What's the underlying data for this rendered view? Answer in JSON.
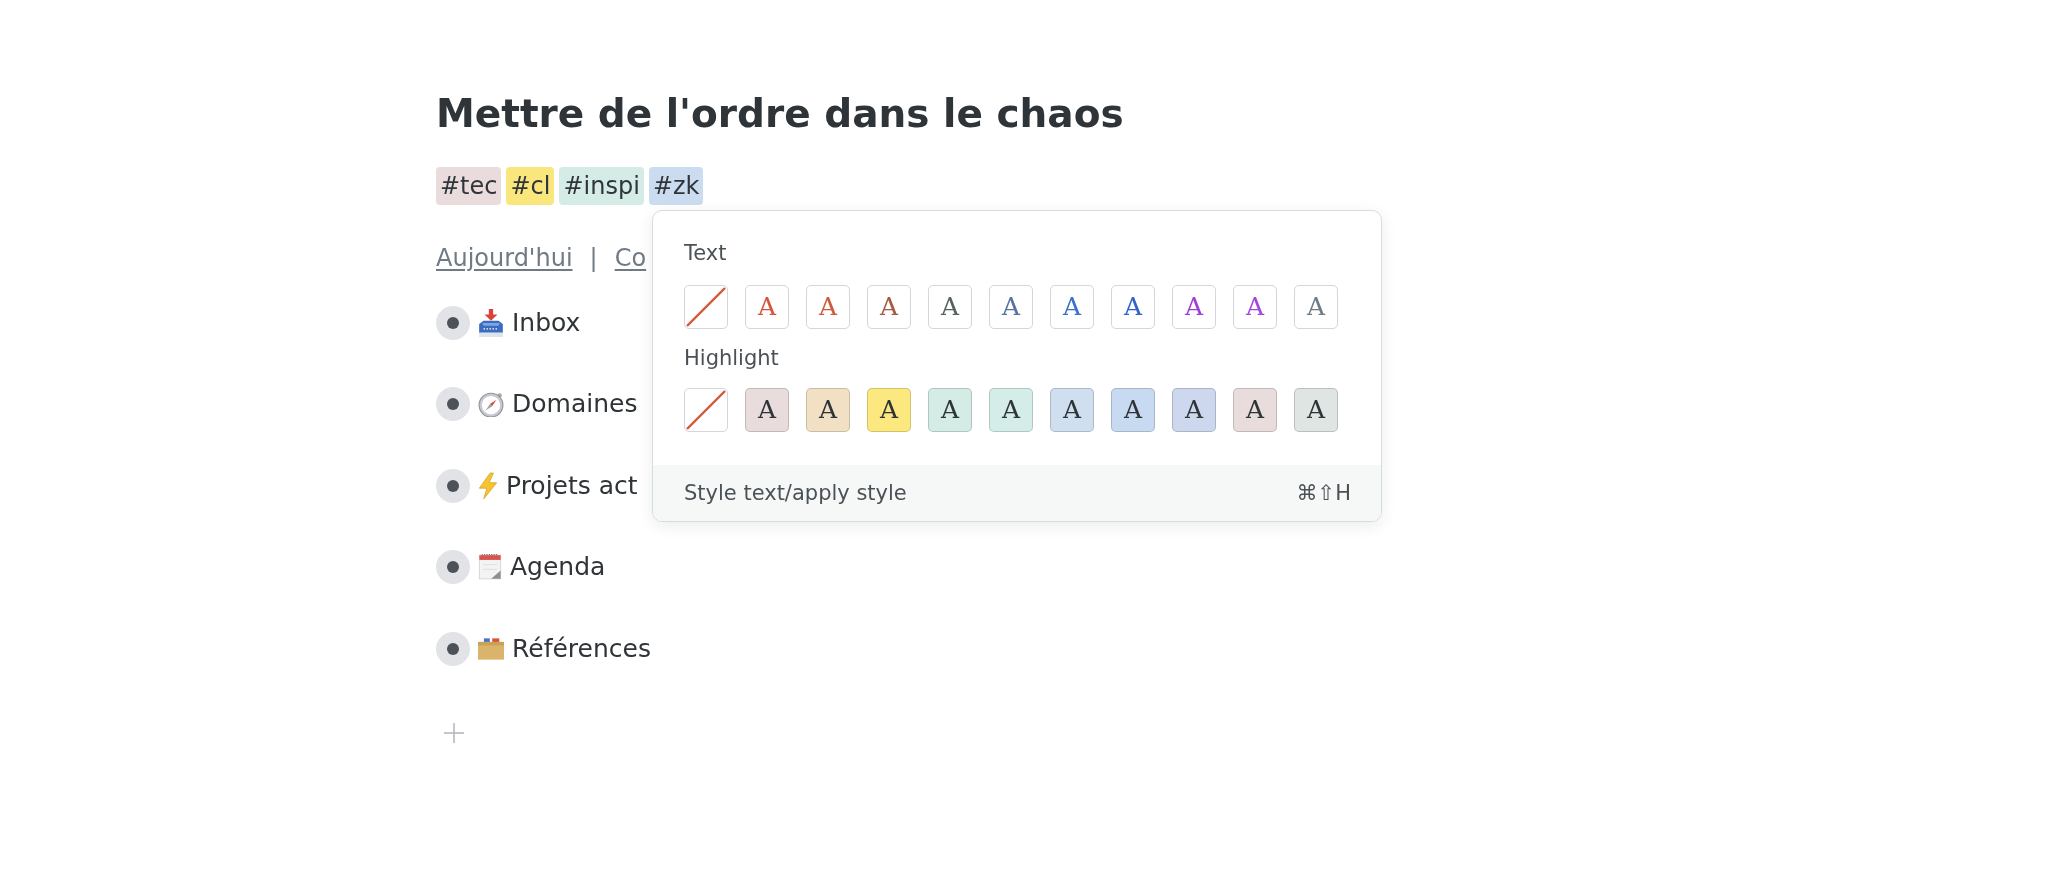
{
  "page": {
    "title": "Mettre de l'ordre dans le chaos"
  },
  "tags": [
    {
      "label": "#tec",
      "color": "#eadcdc"
    },
    {
      "label": "#cl",
      "color": "#f9e77e"
    },
    {
      "label": "#inspi",
      "color": "#d4ece5"
    },
    {
      "label": "#zk",
      "color": "#cbdcf0"
    }
  ],
  "quick_links": {
    "items": [
      "Aujourd'hui",
      "Co"
    ],
    "separator": "|"
  },
  "outline": [
    {
      "label": "Inbox"
    },
    {
      "label": "Domaines"
    },
    {
      "label": "Projets act"
    },
    {
      "label": "Agenda"
    },
    {
      "label": "Références"
    }
  ],
  "style_popup": {
    "sections": [
      {
        "kind": "text",
        "label": "Text",
        "swatches": [
          {
            "kind": "none"
          },
          {
            "kind": "color",
            "letter": "A",
            "color": "#d6553a"
          },
          {
            "kind": "color",
            "letter": "A",
            "color": "#d05a3c"
          },
          {
            "kind": "color",
            "letter": "A",
            "color": "#a45a43"
          },
          {
            "kind": "color",
            "letter": "A",
            "color": "#566460"
          },
          {
            "kind": "color",
            "letter": "A",
            "color": "#5773a3"
          },
          {
            "kind": "color",
            "letter": "A",
            "color": "#3c6fc9"
          },
          {
            "kind": "color",
            "letter": "A",
            "color": "#3263c4"
          },
          {
            "kind": "color",
            "letter": "A",
            "color": "#9c40d8"
          },
          {
            "kind": "color",
            "letter": "A",
            "color": "#a348dc"
          },
          {
            "kind": "color",
            "letter": "A",
            "color": "#6f7c86"
          }
        ]
      },
      {
        "kind": "highlight",
        "label": "Highlight",
        "swatches": [
          {
            "kind": "none"
          },
          {
            "kind": "color",
            "letter": "A",
            "color": "#e8dcdc"
          },
          {
            "kind": "color",
            "letter": "A",
            "color": "#f2e0c4"
          },
          {
            "kind": "color",
            "letter": "A",
            "color": "#fbe87e"
          },
          {
            "kind": "color",
            "letter": "A",
            "color": "#d4ece5"
          },
          {
            "kind": "color",
            "letter": "A",
            "color": "#d5ede8"
          },
          {
            "kind": "color",
            "letter": "A",
            "color": "#cfdff0"
          },
          {
            "kind": "color",
            "letter": "A",
            "color": "#c8daf2"
          },
          {
            "kind": "color",
            "letter": "A",
            "color": "#cdd8ee"
          },
          {
            "kind": "color",
            "letter": "A",
            "color": "#e8dcdc"
          },
          {
            "kind": "color",
            "letter": "A",
            "color": "#dfe5e2"
          }
        ]
      }
    ],
    "footer": {
      "hint": "Style text/apply style",
      "shortcut": "⌘⇧H"
    }
  }
}
